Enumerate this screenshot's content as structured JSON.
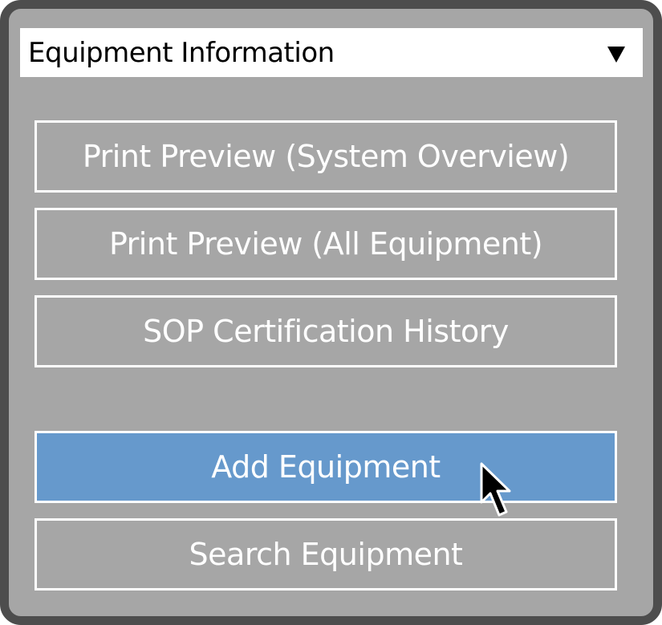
{
  "dropdown": {
    "label": "Equipment Information",
    "icon": "triangle-down-icon"
  },
  "menu": {
    "items": [
      {
        "label": "Print Preview (System Overview)",
        "active": false
      },
      {
        "label": "Print Preview (All Equipment)",
        "active": false
      },
      {
        "label": "SOP Certification History",
        "active": false
      },
      {
        "label": "Add Equipment",
        "active": true
      },
      {
        "label": "Search Equipment",
        "active": false
      }
    ]
  },
  "colors": {
    "panel_background": "#a6a6a6",
    "panel_border": "#4d4d4d",
    "button_border": "#ffffff",
    "active_button": "#6699cc",
    "button_text": "#ffffff"
  },
  "cursor": {
    "icon": "mouse-pointer-icon"
  }
}
